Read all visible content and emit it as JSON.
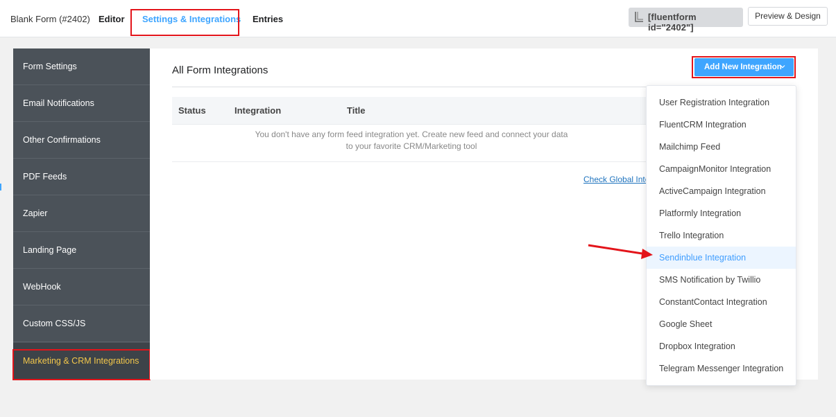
{
  "header": {
    "form_name": "Blank Form (#2402)",
    "tabs": [
      {
        "label": "Editor"
      },
      {
        "label": "Settings & Integrations"
      },
      {
        "label": "Entries"
      }
    ],
    "shortcode": "[fluentform id=\"2402\"]",
    "preview_label": "Preview & Design"
  },
  "sidebar": {
    "items": [
      {
        "label": "Form Settings"
      },
      {
        "label": "Email Notifications"
      },
      {
        "label": "Other Confirmations"
      },
      {
        "label": "PDF Feeds"
      },
      {
        "label": "Zapier"
      },
      {
        "label": "Landing Page"
      },
      {
        "label": "WebHook"
      },
      {
        "label": "Custom CSS/JS"
      },
      {
        "label": "Marketing & CRM Integrations"
      }
    ]
  },
  "main": {
    "title": "All Form Integrations",
    "add_button_label": "Add New Integration",
    "columns": [
      "Status",
      "Integration",
      "Title"
    ],
    "empty_line1": "You don't have any form feed integration yet. Create new feed and connect your data",
    "empty_line2": "to your favorite CRM/Marketing tool",
    "global_link": "Check Global Inte"
  },
  "dropdown": {
    "items": [
      {
        "label": "User Registration Integration"
      },
      {
        "label": "FluentCRM Integration"
      },
      {
        "label": "Mailchimp Feed"
      },
      {
        "label": "CampaignMonitor Integration"
      },
      {
        "label": "ActiveCampaign Integration"
      },
      {
        "label": "Platformly Integration"
      },
      {
        "label": "Trello Integration"
      },
      {
        "label": "Sendinblue Integration"
      },
      {
        "label": "SMS Notification by Twillio"
      },
      {
        "label": "ConstantContact Integration"
      },
      {
        "label": "Google Sheet"
      },
      {
        "label": "Dropbox Integration"
      },
      {
        "label": "Telegram Messenger Integration"
      }
    ]
  },
  "colors": {
    "accent": "#3ea5ff",
    "sidebar_bg": "#4b5259",
    "active_text": "#f3c74a",
    "highlight_box": "#e3141a"
  }
}
